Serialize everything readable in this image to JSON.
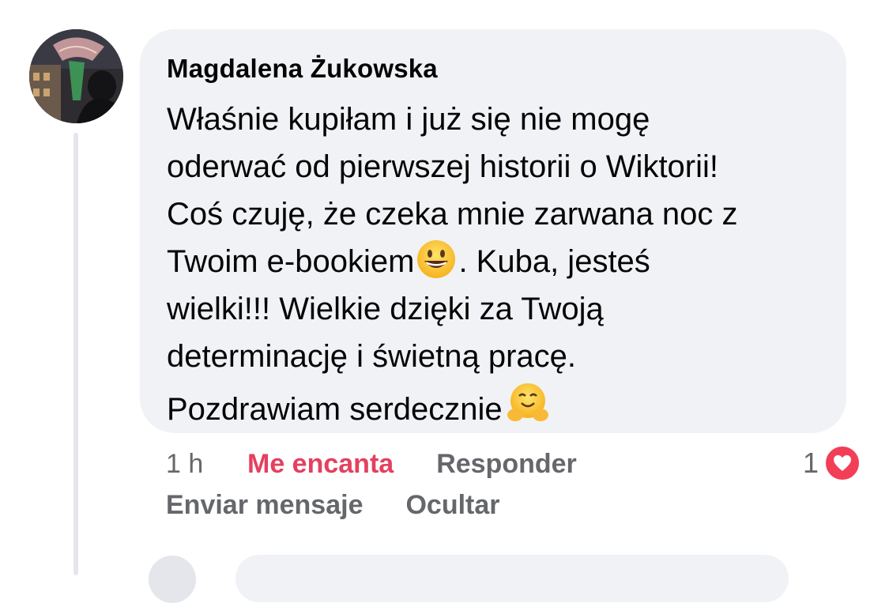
{
  "comment": {
    "author": "Magdalena Żukowska",
    "lines": {
      "l1": "Właśnie kupiłam i już się nie mogę",
      "l2": "oderwać od pierwszej historii o Wiktorii!",
      "l3": "Coś czuję, że czeka mnie zarwana noc z",
      "l4a": "Twoim e-bookiem",
      "l4b": ". Kuba, jesteś",
      "l5": "wielki!!! Wielkie dzięki za Twoją",
      "l6": "determinację i świetną pracę.",
      "l7": "Pozdrawiam serdecznie"
    },
    "emojis": {
      "grin": "grinning-face-emoji",
      "hug": "hugging-face-emoji"
    }
  },
  "actions": {
    "time": "1 h",
    "love": "Me encanta",
    "reply": "Responder",
    "send_message": "Enviar mensaje",
    "hide": "Ocultar"
  },
  "reactions": {
    "count": "1",
    "icon": "heart-reaction-icon"
  },
  "colors": {
    "love": "#e4405f",
    "bubble": "#f0f2f5",
    "secondary_text": "#65676b",
    "heart": "#f33e58"
  }
}
